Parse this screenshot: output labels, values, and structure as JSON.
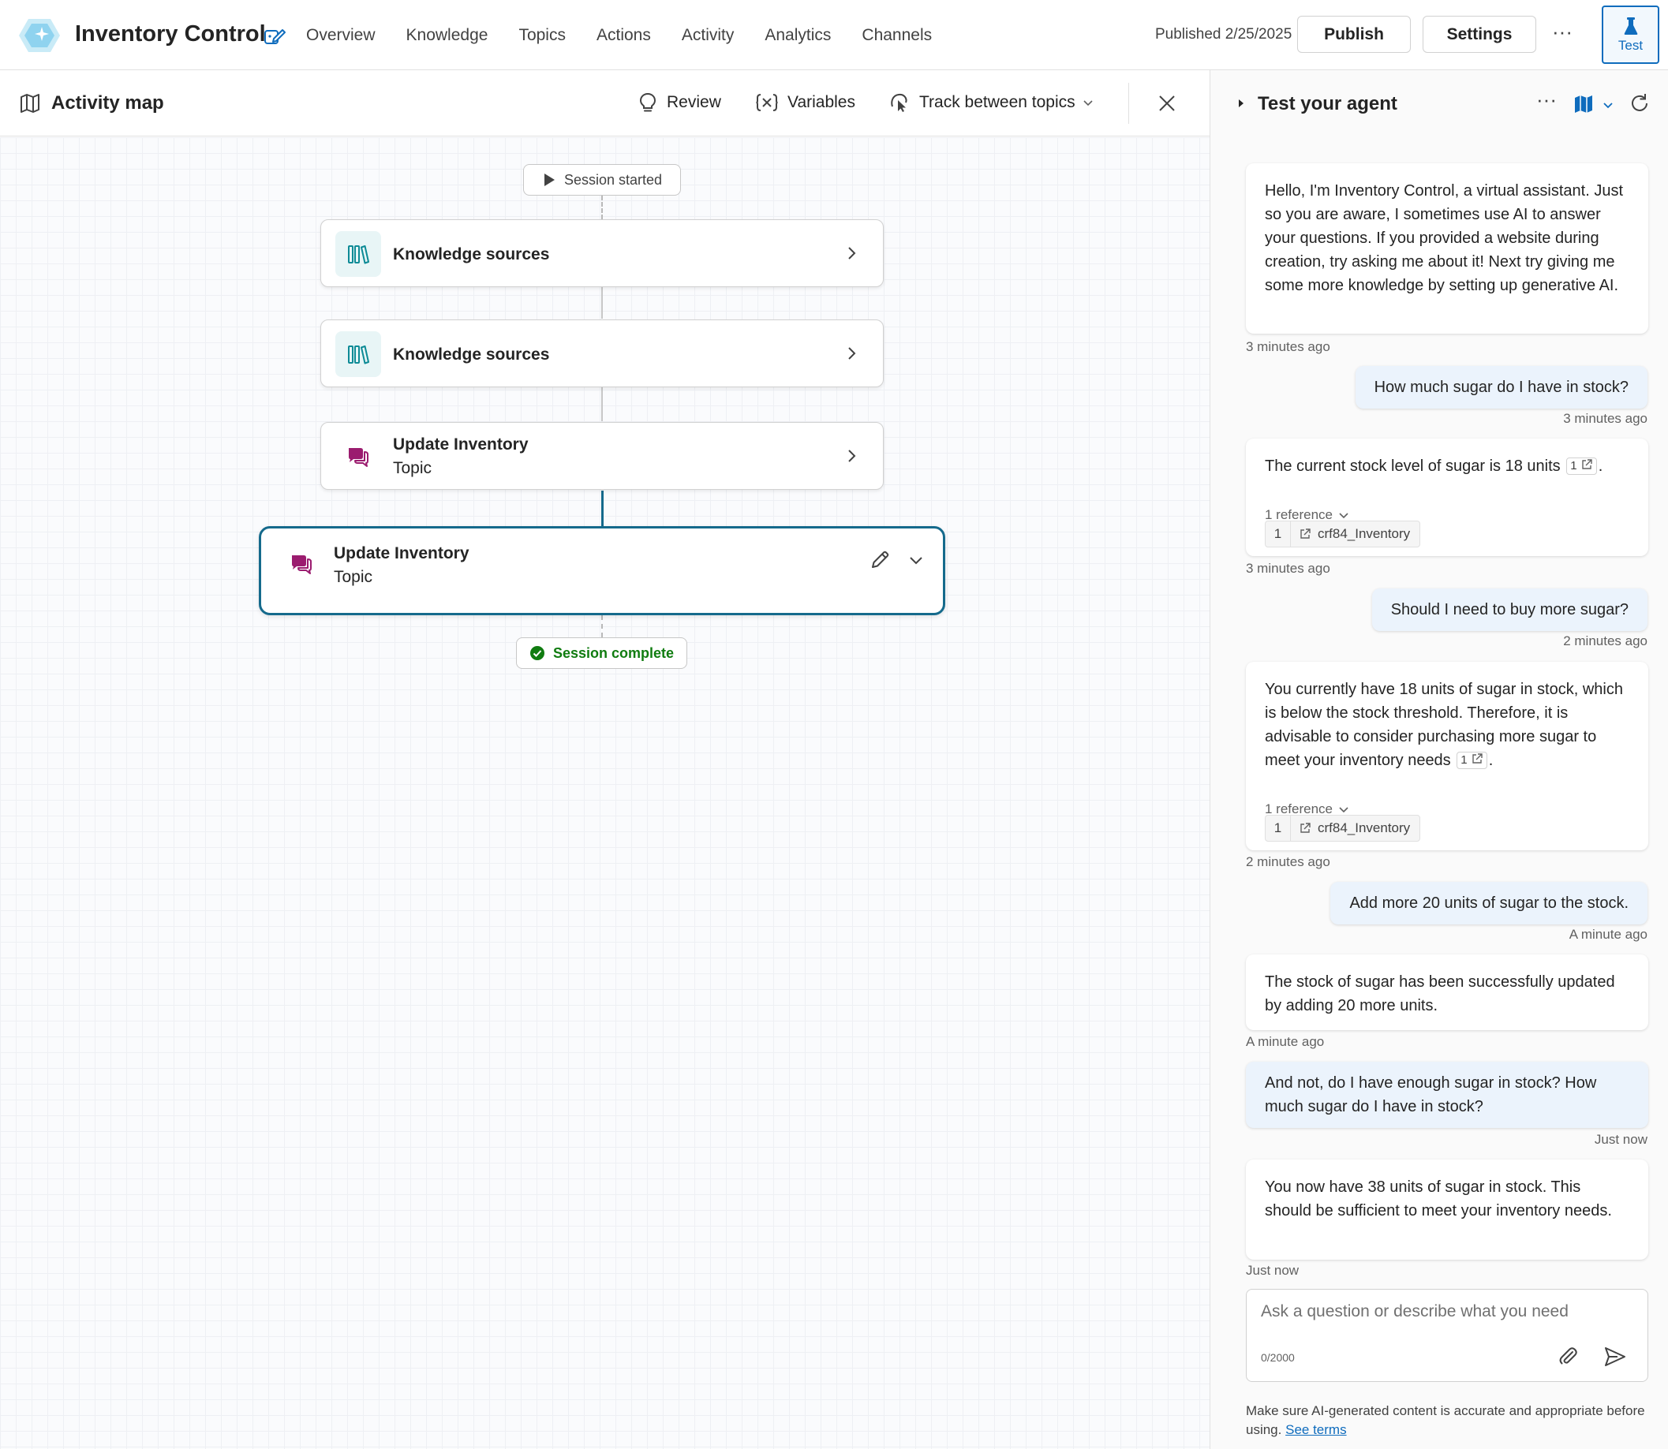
{
  "app": {
    "title": "Inventory Control",
    "published": "Published 2/25/2025"
  },
  "nav": [
    "Overview",
    "Knowledge",
    "Topics",
    "Actions",
    "Activity",
    "Analytics",
    "Channels"
  ],
  "toolbar": {
    "publish_label": "Publish",
    "settings_label": "Settings",
    "more_label": "···",
    "test_label": "Test"
  },
  "activity_map": {
    "title": "Activity map",
    "tools": {
      "review": "Review",
      "variables": "Variables",
      "track": "Track between topics"
    },
    "session_started": "Session started",
    "session_complete": "Session complete",
    "nodes": [
      {
        "label": "Knowledge sources",
        "icon": "library-icon"
      },
      {
        "label": "Knowledge sources",
        "icon": "library-icon"
      },
      {
        "label": "Update Inventory",
        "sub": "Topic",
        "icon": "chat-bubbles-icon"
      }
    ],
    "selected_node": {
      "label": "Update Inventory",
      "sub": "Topic",
      "icon": "chat-bubbles-icon"
    }
  },
  "test_panel": {
    "title": "Test your agent",
    "messages": [
      {
        "role": "bot",
        "text": "Hello, I'm Inventory Control, a virtual assistant. Just so you are aware, I sometimes use AI to answer your questions. If you provided a website during creation, try asking me about it! Next try giving me some more knowledge by setting up generative AI.",
        "time": "3 minutes ago"
      },
      {
        "role": "user",
        "text": "How much sugar do I have in stock?",
        "time": "3 minutes ago"
      },
      {
        "role": "bot",
        "text": "The current stock level of sugar is 18 units",
        "ref_badge": "1",
        "ref_toggle": "1 reference",
        "ref_num": "1",
        "ref_name": "crf84_Inventory",
        "time": "3 minutes ago"
      },
      {
        "role": "user",
        "text": "Should I need to buy more sugar?",
        "time": "2 minutes ago"
      },
      {
        "role": "bot",
        "text": "You currently have 18 units of sugar in stock, which is below the stock threshold. Therefore, it is advisable to consider purchasing more sugar to meet your inventory needs",
        "ref_badge": "1",
        "ref_toggle": "1 reference",
        "ref_num": "1",
        "ref_name": "crf84_Inventory",
        "time": "2 minutes ago"
      },
      {
        "role": "user",
        "text": "Add more 20 units of sugar to the stock.",
        "time": "A minute ago"
      },
      {
        "role": "bot",
        "text": "The stock of sugar has been successfully updated by adding 20 more units.",
        "time": "A minute ago"
      },
      {
        "role": "user",
        "text": "And not, do I have enough sugar in stock? How much sugar do I have in stock?",
        "time": "Just now"
      },
      {
        "role": "bot",
        "text": "You now have 38 units of sugar in stock. This should be sufficient to meet your inventory needs.",
        "time": "Just now"
      }
    ],
    "input": {
      "placeholder": "Ask a question or describe what you need",
      "counter": "0/2000"
    },
    "disclaimer": {
      "text": "Make sure AI-generated content is accurate and appropriate before using.",
      "link": "See terms"
    }
  },
  "colors": {
    "accent": "#0f6cbd",
    "teal": "#156a8c",
    "topic": "#9b1c6f",
    "success": "#107c10"
  }
}
